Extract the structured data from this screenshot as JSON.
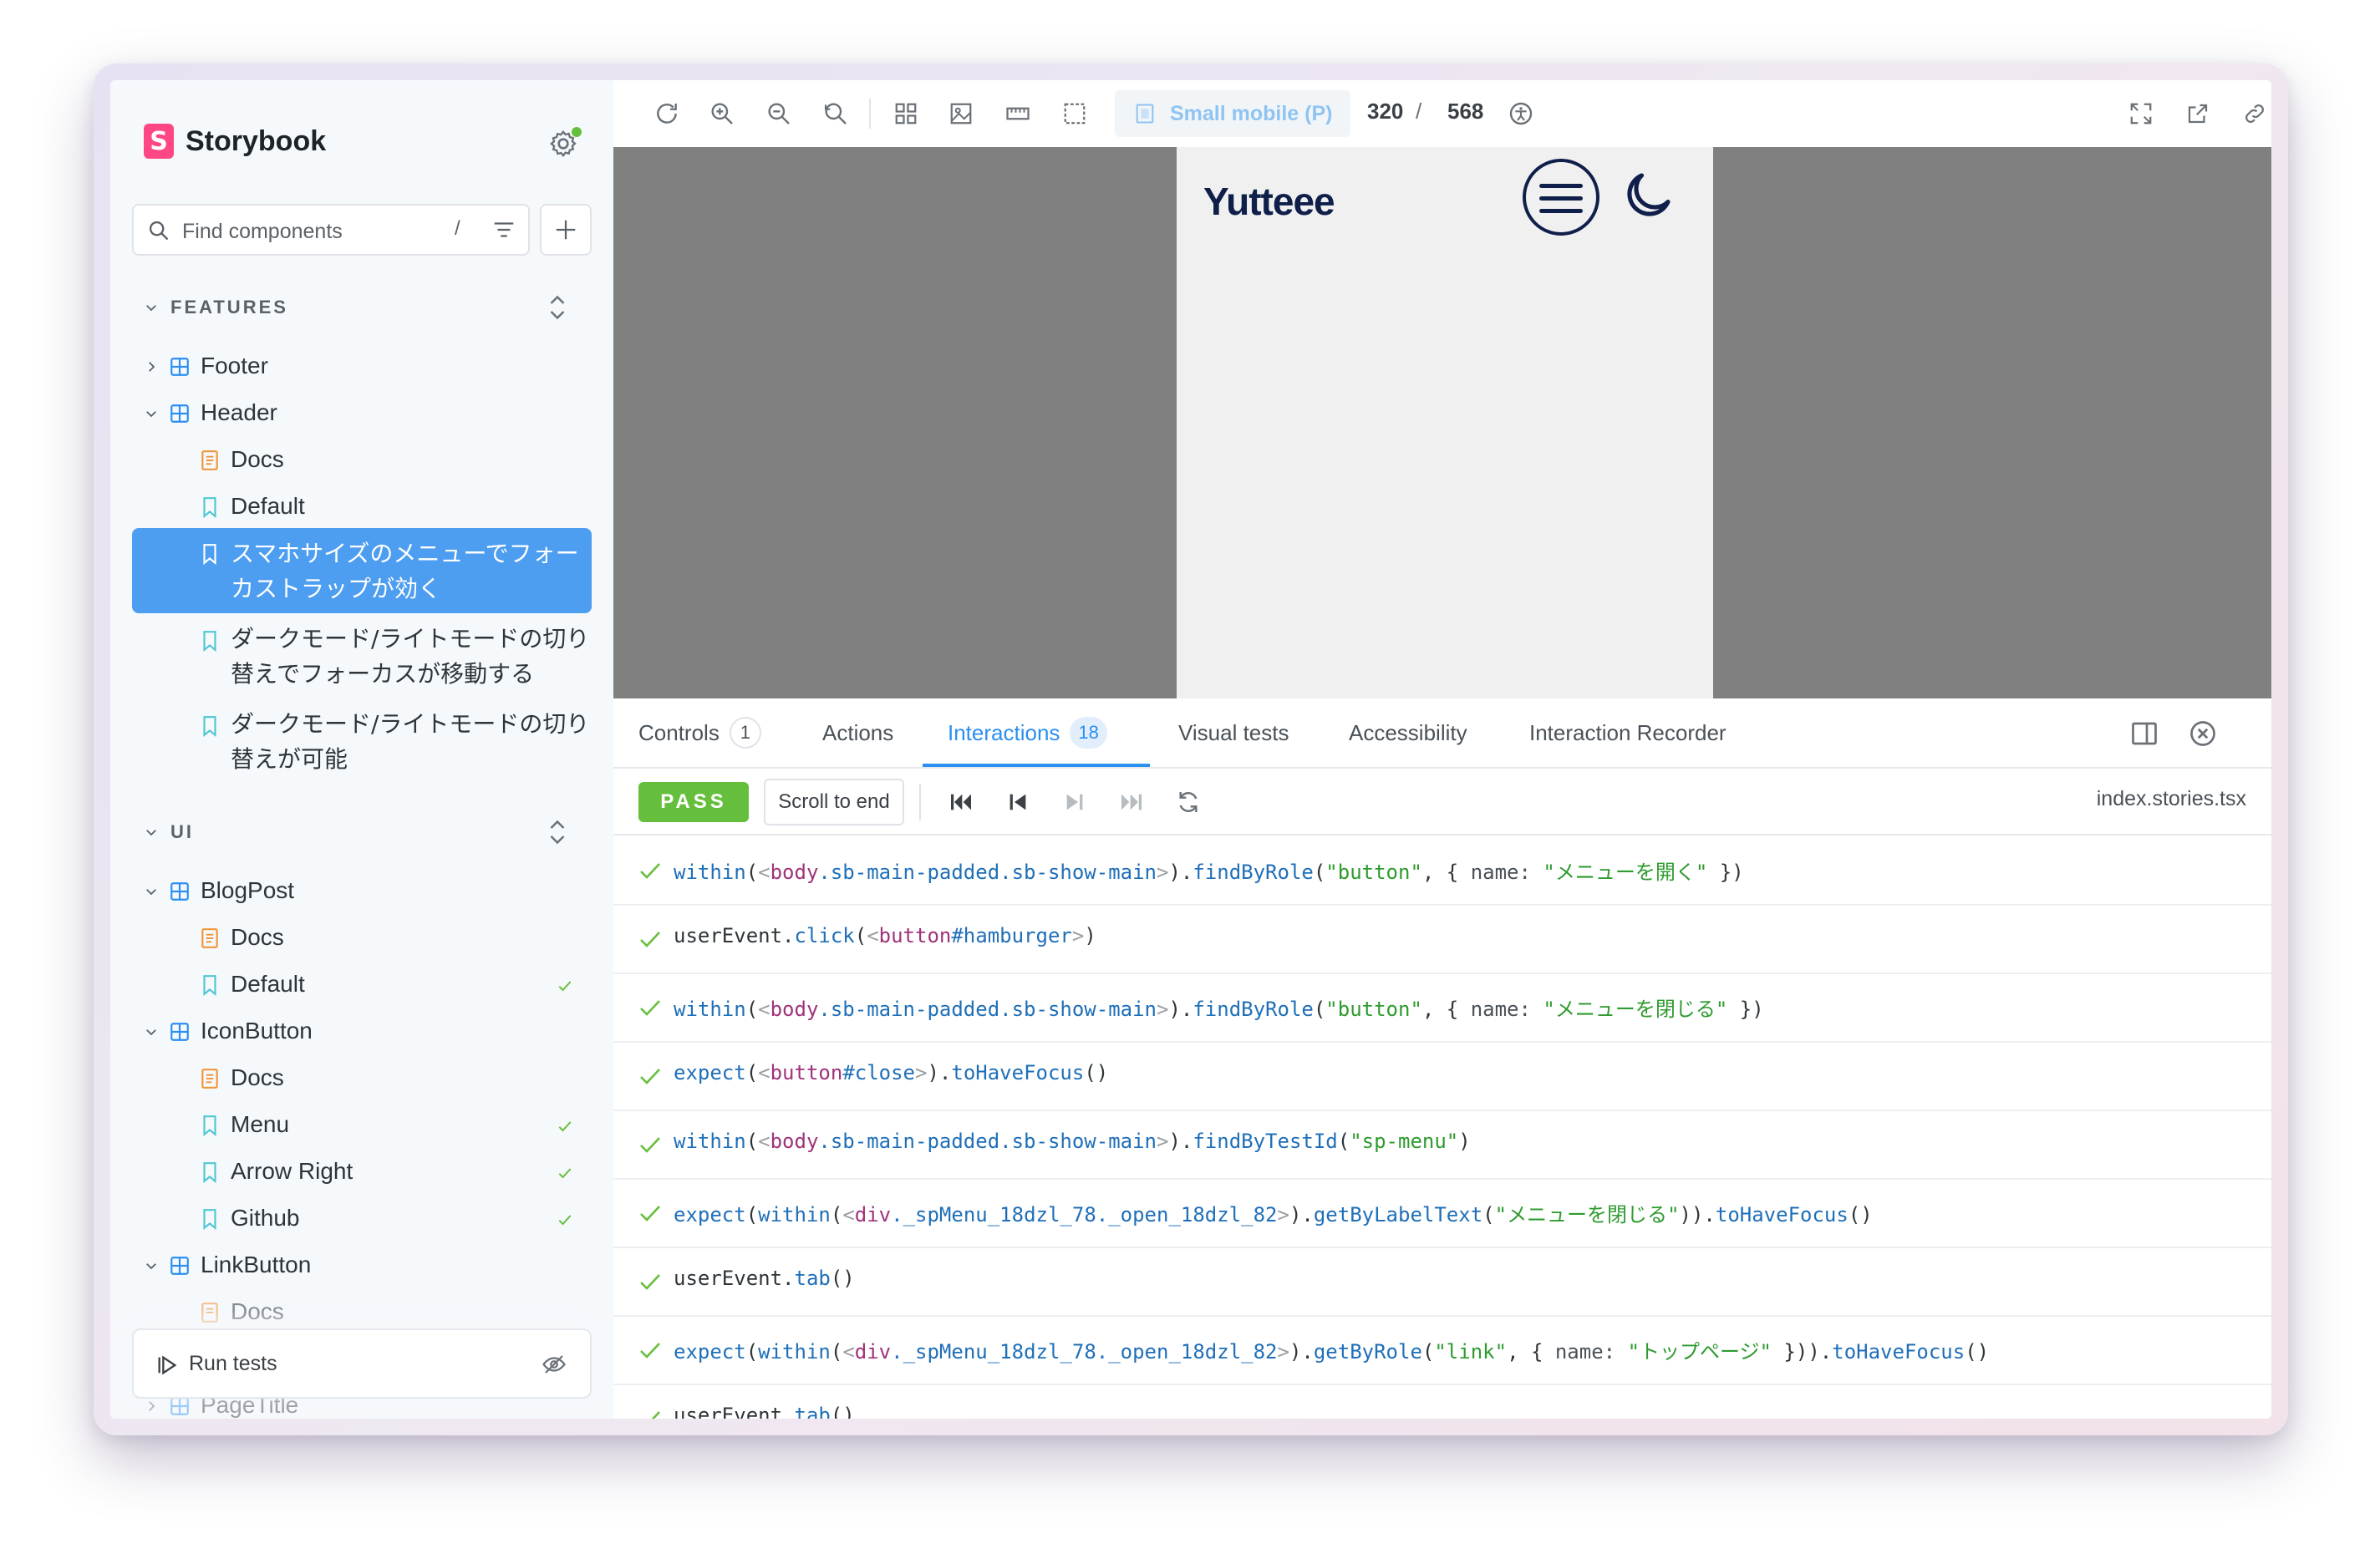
{
  "app": {
    "name": "Storybook"
  },
  "sidebar": {
    "search_placeholder": "Find components",
    "search_shortcut": "/",
    "groups": [
      {
        "label": "FEATURES"
      },
      {
        "label": "UI"
      }
    ],
    "features": {
      "footer": "Footer",
      "header": "Header",
      "docs": "Docs",
      "default": "Default",
      "selected_story": "スマホサイズのメニューでフォーカストラップが効く",
      "story_dark_focus": "ダークモード/ライトモードの切り替えでフォーカスが移動する",
      "story_dark_toggle": "ダークモード/ライトモードの切り替えが可能"
    },
    "ui": {
      "blogpost": "BlogPost",
      "blogpost_docs": "Docs",
      "blogpost_default": "Default",
      "iconbutton": "IconButton",
      "iconbutton_docs": "Docs",
      "menu": "Menu",
      "arrow_right": "Arrow Right",
      "github": "Github",
      "linkbutton": "LinkButton",
      "linkbutton_docs": "Docs",
      "pagetitle": "PageTitle"
    },
    "run_tests": "Run tests"
  },
  "toolbar": {
    "viewport": "Small mobile (P)",
    "width": "320",
    "separator": "/",
    "height": "568"
  },
  "preview": {
    "site_title": "Yutteee"
  },
  "addons": {
    "tabs": [
      {
        "label": "Controls",
        "badge": "1"
      },
      {
        "label": "Actions"
      },
      {
        "label": "Interactions",
        "badge": "18"
      },
      {
        "label": "Visual tests"
      },
      {
        "label": "Accessibility"
      },
      {
        "label": "Interaction Recorder"
      }
    ],
    "status": "PASS",
    "scroll_to_end": "Scroll to end",
    "filename": "index.stories.tsx",
    "steps": {
      "s1": {
        "name": "メニューを開く"
      },
      "s3": {
        "name": "メニューを閉じる"
      },
      "s5": {
        "testid": "sp-menu"
      },
      "s6": {
        "label": "メニューを閉じる"
      },
      "s8": {
        "name": "トップページ"
      }
    }
  },
  "colors": {
    "accent": "#2b8ff0",
    "selected": "#4d9ef0",
    "pass": "#66bf3c",
    "brand": "#ff4785"
  }
}
